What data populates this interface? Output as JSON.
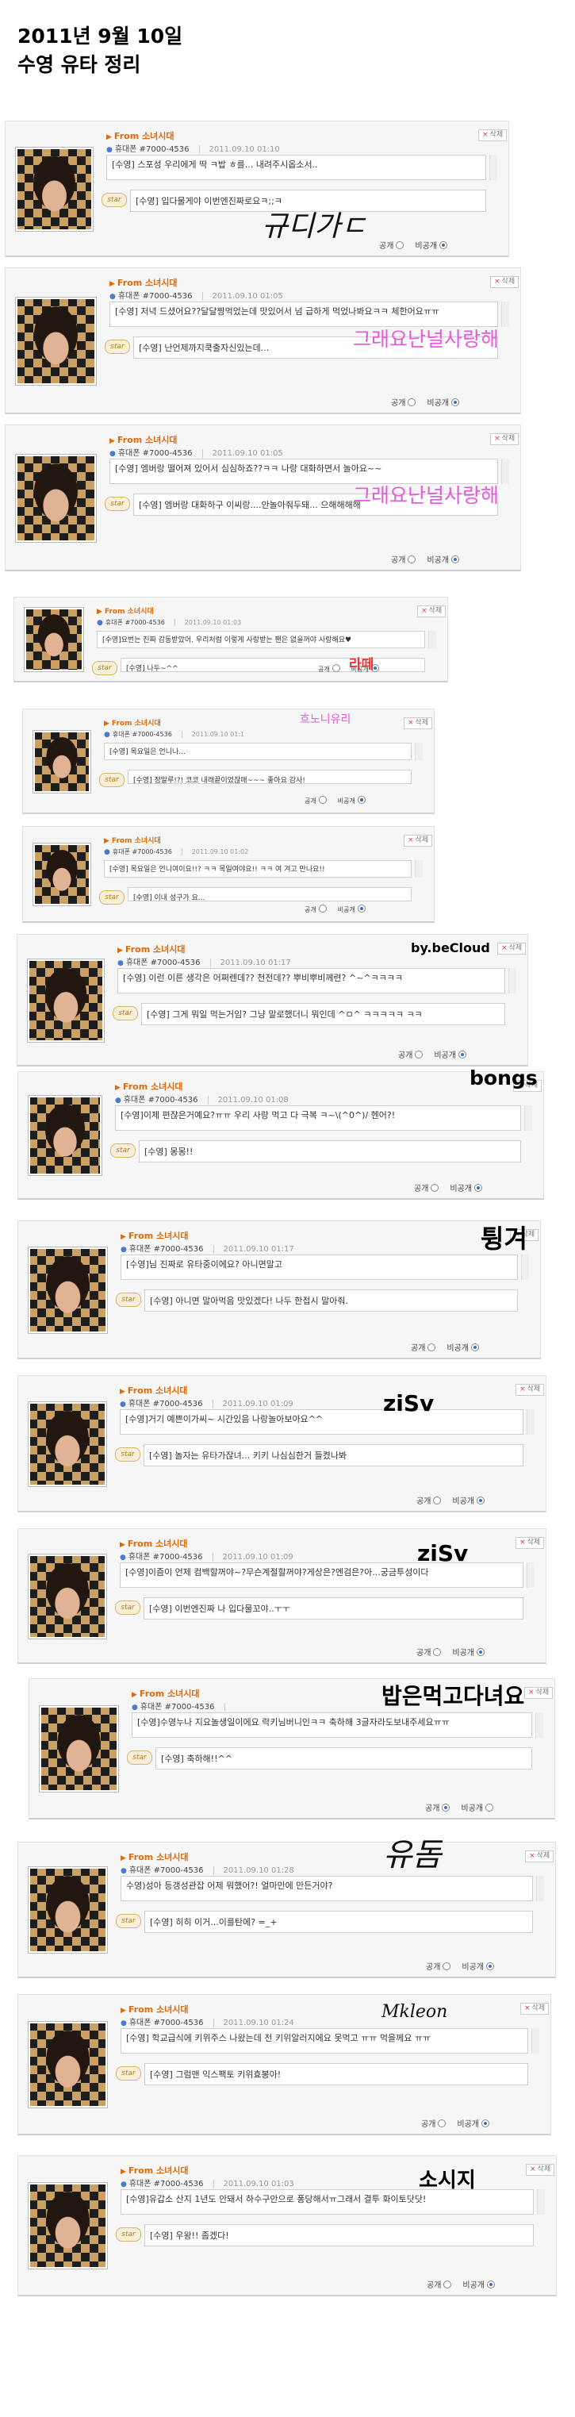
{
  "page": {
    "title_line1": "2011년 9월 10일",
    "title_line2": "수영 유타 정리"
  },
  "common": {
    "from": "From 소녀시대",
    "sender": "휴대폰 #7000-4536",
    "reply_name": "[수영]",
    "delete": "삭제",
    "star": "star",
    "public": "공개",
    "private": "비공개"
  },
  "messages": [
    {
      "timestamp": "2011.09.10 01:10",
      "message": "[수영] 스포성 우리에게 딱 ㅋ밥 ㅎ를... 내려주시옵소서..",
      "reply": "[수영] 입다물게야 이번엔진짜로요ㅋ;;ㅋ",
      "signature": "규디가ㄷ",
      "public_selected": false
    },
    {
      "timestamp": "2011.09.10 01:05",
      "message": "[수영] 저녁 드셨어요??달달짱먹었는데 맛있어서 넘 급하게 먹었나봐요ㅋㅋ 체한어요ㅠㅠ",
      "reply": "[수영] 난언제까지쿡출자신있는데...",
      "signature": "그래요난널사랑해",
      "public_selected": false
    },
    {
      "timestamp": "2011.09.10 01:05",
      "message": "[수영] 엠버랑 떨어져 있어서 심심하죠??ㅋㅋ 나랑 대화하면서 놀아요~~",
      "reply": "[수영] 엠버랑 대화하구 이씨랑....안놀아줘두돼... 으해해해해",
      "signature": "그래요난널사랑해",
      "public_selected": false
    },
    {
      "timestamp": "2011.09.10 01:03",
      "message": "[수영]요번는 진짜 감동받았어. 우리처럼 이렇게 사랑받는 팬은 없을꺼야 사랑해요♥",
      "reply": "[수영] 나두~^^",
      "signature": "라떼",
      "public_selected": false
    },
    {
      "timestamp": "2011.09.10 01:1",
      "message": "[수영] 목요일은 언니나...",
      "reply": "[수영] 정말루!?! 코코 내래끝이었잖매~~~ 좋아요 감사!",
      "signature": "흐노니유리",
      "public_selected": false
    },
    {
      "timestamp": "2011.09.10 01:02",
      "message": "[수영] 목요일은 언니여이요!!? ㅋㅋ 목일여야요!! ㅋㅋ 여 겨고 만나요!!",
      "reply": "[수영] 이내 성구가 요...",
      "signature": "",
      "public_selected": false
    },
    {
      "timestamp": "2011.09.10 01:17",
      "message": "[수영] 이런 이른 생각은 어쩌렌데?? 천전데?? 뿌비뿌비께련? ^~^ㅋㅋㅋㅋ",
      "reply": "[수영] 그게 뭐일 먹는거임? 그냥 말로했더니 뭐인데 ^ㅁ^ ㅋㅋㅋㅋㅋ ㅋㅋ",
      "signature": "by.beCloud",
      "public_selected": false
    },
    {
      "timestamp": "2011.09.10 01:08",
      "message": "[수영]이제 편잖은거예요?ㅠㅠ 우리 사랑 먹고 다 극복 ㅋ~\\(^0^)/ 헨어?!",
      "reply": "[수영] 몽몽!!",
      "signature": "bongs",
      "public_selected": false
    },
    {
      "timestamp": "2011.09.10 01:17",
      "message": "[수영]님 진짜로 유타중이에요? 아니면말고",
      "reply": "[수영] 아니면 말아먹음 맛있겠다! 나두 한접시 말아줘.",
      "signature": "튕겨",
      "public_selected": false
    },
    {
      "timestamp": "2011.09.10 01:09",
      "message": "[수영]거기 예쁜이가씨~ 시간있음 나랑놀아보아요^^",
      "reply": "[수영] 놀자는 유타가잖녀... 키키 나심심한거 들켰나봐",
      "signature": "ziSv",
      "public_selected": false
    },
    {
      "timestamp": "2011.09.10 01:09",
      "message": "[수영]이즘이 언제 컴백할꺼야~?무슨계절할꺼야?게상은?엔검은?아...궁금투성이다",
      "reply": "[수영] 이번엔진짜 나 입다물꼬야..ㅜㅜ",
      "signature": "ziSv",
      "public_selected": false
    },
    {
      "timestamp": "",
      "message": "[수영]수영누나 지요놀생일이에요 락키님버니인ㅋㅋ 축하해 3글자라도보내주세요ㅠㅠ",
      "reply": "[수영] 축하해!!^^",
      "signature": "밥은먹고다녀요",
      "public_selected": true
    },
    {
      "timestamp": "2011.09.10 01:28",
      "message": "수영)성아 등갱성관잡 어제 뭐했어?! 얼마만에 만든거야?",
      "reply": "[수영] 히히 이거...이를탄에? =_+",
      "signature": "유돔",
      "public_selected": false
    },
    {
      "timestamp": "2011.09.10 01:24",
      "message": "[수영] 학교급식에 키위주스 나왔는데 전 키위알러지에요 못먹고 ㅠㅠ 먹을께요 ㅠㅠ",
      "reply": "[수영] 그럼맨 익스팩토 키위효봉아!",
      "signature": "Mkleon",
      "public_selected": false
    },
    {
      "timestamp": "2011.09.10 01:03",
      "message": "[수영]유갑소 산지 1년도 안돼서 하수구안으로 퐁당해서ㅠ그래서 결투 화이토닷닷!",
      "reply": "[수영] 우왕!! 좀겠다!",
      "signature": "소시지",
      "public_selected": false
    }
  ]
}
